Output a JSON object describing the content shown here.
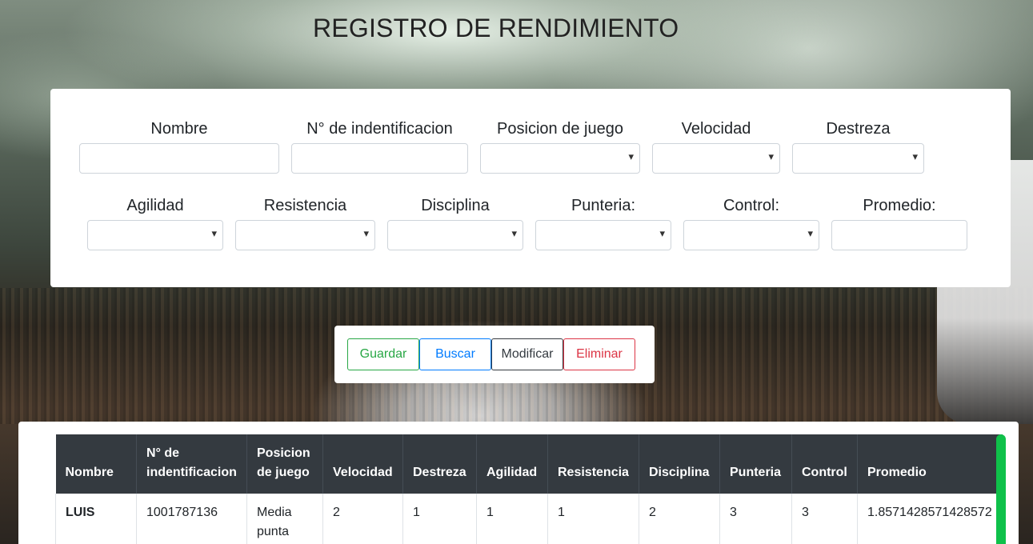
{
  "title": "REGISTRO DE RENDIMIENTO",
  "form": {
    "nombre": {
      "label": "Nombre",
      "value": ""
    },
    "identificacion": {
      "label": "N° de indentificacion",
      "value": ""
    },
    "posicion": {
      "label": "Posicion de juego",
      "value": ""
    },
    "velocidad": {
      "label": "Velocidad",
      "value": ""
    },
    "destreza": {
      "label": "Destreza",
      "value": ""
    },
    "agilidad": {
      "label": "Agilidad",
      "value": ""
    },
    "resistencia": {
      "label": "Resistencia",
      "value": ""
    },
    "disciplina": {
      "label": "Disciplina",
      "value": ""
    },
    "punteria": {
      "label": "Punteria:",
      "value": ""
    },
    "control": {
      "label": "Control:",
      "value": ""
    },
    "promedio": {
      "label": "Promedio:",
      "value": ""
    }
  },
  "buttons": {
    "guardar": "Guardar",
    "buscar": "Buscar",
    "modificar": "Modificar",
    "eliminar": "Eliminar"
  },
  "table": {
    "headers": {
      "nombre": "Nombre",
      "identificacion_l1": "N° de",
      "identificacion_l2": "indentificacion",
      "posicion_l1": "Posicion",
      "posicion_l2": "de juego",
      "velocidad": "Velocidad",
      "destreza": "Destreza",
      "agilidad": "Agilidad",
      "resistencia": "Resistencia",
      "disciplina": "Disciplina",
      "punteria": "Punteria",
      "control": "Control",
      "promedio": "Promedio"
    },
    "rows": [
      {
        "nombre": "LUIS",
        "identificacion": "1001787136",
        "posicion_l1": "Media",
        "posicion_l2": "punta",
        "velocidad": "2",
        "destreza": "1",
        "agilidad": "1",
        "resistencia": "1",
        "disciplina": "2",
        "punteria": "3",
        "control": "3",
        "promedio": "1.8571428571428572"
      }
    ]
  },
  "colors": {
    "guardar": "#28a745",
    "buscar": "#007bff",
    "modificar": "#343a40",
    "eliminar": "#dc3545",
    "table_header": "#343a40",
    "scrollbar": "#0fc14a"
  }
}
